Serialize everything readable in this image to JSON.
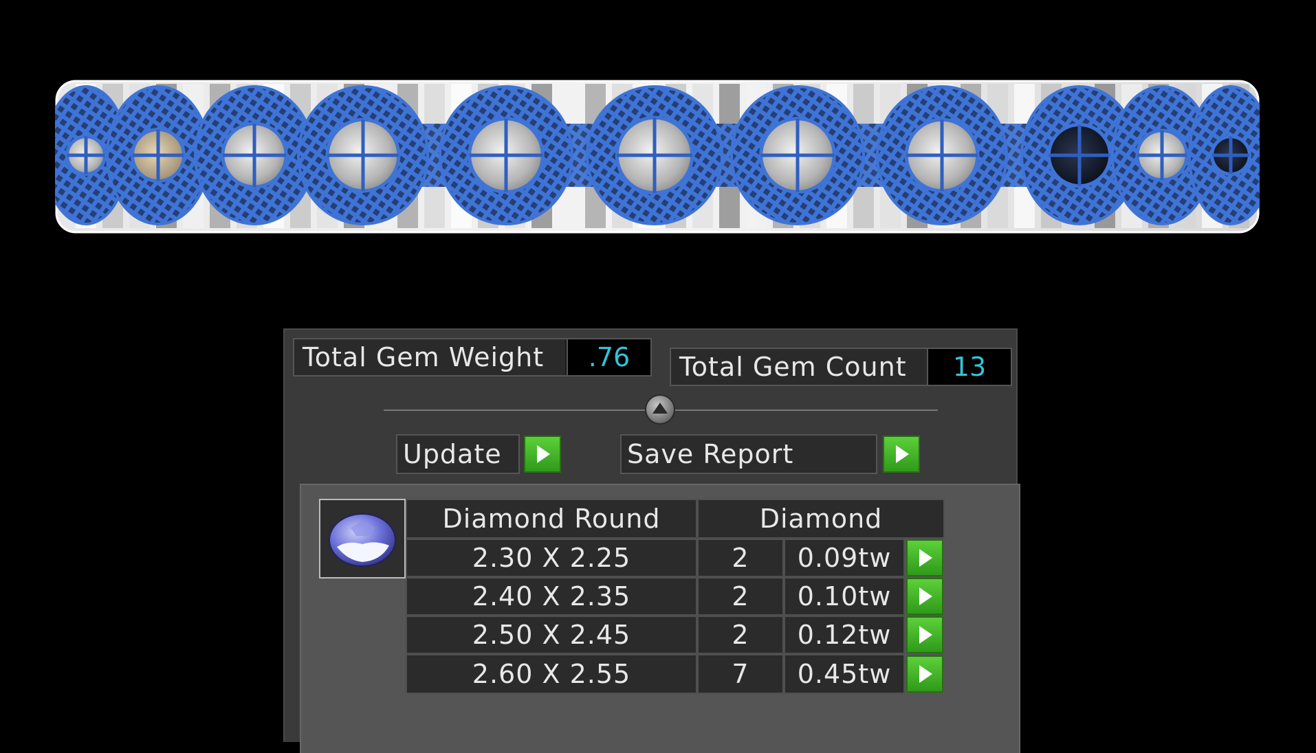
{
  "stats": {
    "total_weight_label": "Total Gem Weight",
    "total_weight_value": ".76",
    "total_count_label": "Total Gem Count",
    "total_count_value": "13"
  },
  "actions": {
    "update_label": "Update",
    "save_report_label": "Save Report"
  },
  "gem_table": {
    "shape_header": "Diamond Round",
    "material_header": "Diamond",
    "rows": [
      {
        "size": "2.30 X 2.25",
        "count": "2",
        "weight": "0.09tw"
      },
      {
        "size": "2.40 X 2.35",
        "count": "2",
        "weight": "0.10tw"
      },
      {
        "size": "2.50 X 2.45",
        "count": "2",
        "weight": "0.12tw"
      },
      {
        "size": "2.60 X 2.55",
        "count": "7",
        "weight": "0.45tw"
      }
    ]
  },
  "colors": {
    "wireframe": "#3f74d6",
    "value_text": "#33c4d8",
    "go_button": "#3fb525"
  },
  "icons": {
    "collapse": "chevron-up-icon",
    "go": "play-arrow-icon",
    "gem_thumbnail": "round-gem-icon"
  }
}
